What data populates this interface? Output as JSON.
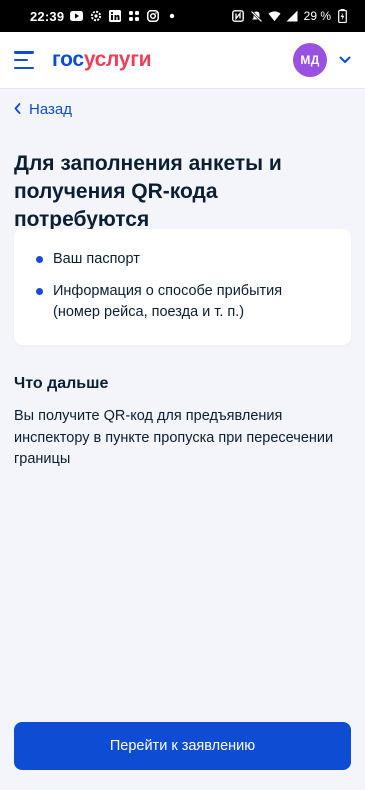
{
  "status_bar": {
    "time": "22:39",
    "battery": "29 %",
    "left_icons": [
      "youtube-icon",
      "gear-badge-icon",
      "linkedin-icon",
      "slack-icon",
      "instagram-icon",
      "dot-icon"
    ],
    "right_icons": [
      "nfc-icon",
      "mute-icon",
      "wifi-icon",
      "signal-icon",
      "battery-icon"
    ]
  },
  "header": {
    "logo_part1": "гос",
    "logo_part2": "услуги",
    "avatar_initials": "МД",
    "avatar_color": "#9b51e0"
  },
  "nav": {
    "back_label": "Назад"
  },
  "main": {
    "title": "Для заполнения анкеты и получения QR-кода потребуются",
    "requirements": [
      "Ваш паспорт",
      "Информация о способе прибытия (номер рейса, поезда и т. п.)"
    ],
    "next_title": "Что дальше",
    "next_text": "Вы получите QR-код для предъявления инспектору в пункте пропуска при пересечении границы"
  },
  "actions": {
    "primary_label": "Перейти к заявлению"
  },
  "colors": {
    "accent": "#0d4cd3",
    "brand_red": "#ee3f58",
    "background": "#f3f5fa",
    "text": "#0b1f33"
  }
}
